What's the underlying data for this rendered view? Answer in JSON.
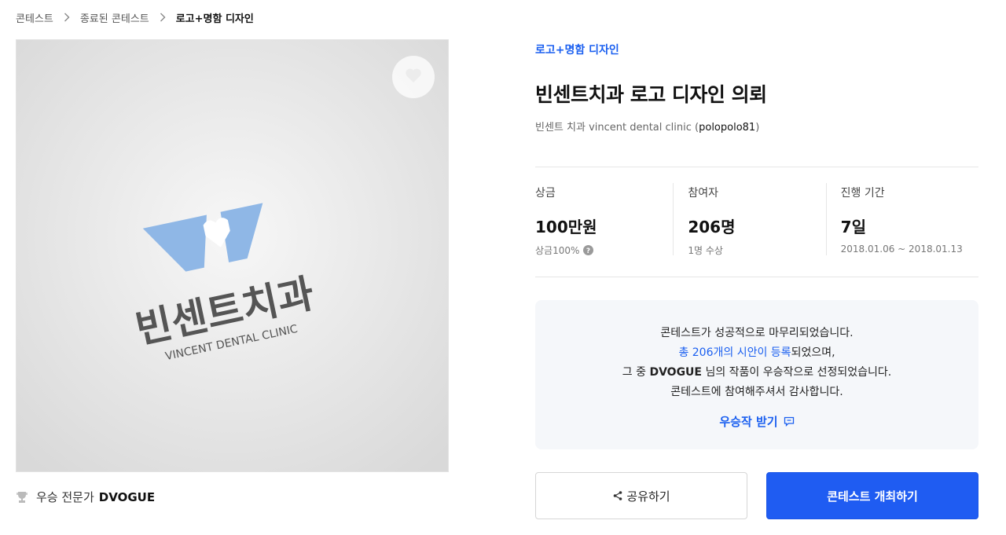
{
  "breadcrumb": {
    "items": [
      "콘테스트",
      "종료된 콘테스트",
      "로고+명함 디자인"
    ]
  },
  "image": {
    "logo_main_text": "빈센트치과",
    "logo_sub_text": "VINCENT DENTAL CLINIC",
    "like_icon": "heart-icon"
  },
  "winner": {
    "label": "우승 전문가",
    "name": "DVOGUE"
  },
  "contest": {
    "category": "로고+명함 디자인",
    "title": "빈센트치과 로고 디자인 의뢰",
    "subtitle_prefix": "빈센트 치과 vincent dental clinic (",
    "owner": "polopolo81",
    "subtitle_suffix": ")"
  },
  "stats": {
    "prize": {
      "label": "상금",
      "value": "100만원",
      "sub": "상금100%"
    },
    "participants": {
      "label": "참여자",
      "value": "206명",
      "sub": "1명 수상"
    },
    "period": {
      "label": "진행 기간",
      "value": "7일",
      "sub": "2018.01.06 ~ 2018.01.13"
    }
  },
  "notice": {
    "line1": "콘테스트가 성공적으로 마무리되었습니다.",
    "line2_link": "총 206개의 시안이 등록",
    "line2_rest": "되었으며,",
    "line3_prefix": "그 중 ",
    "line3_name": "DVOGUE",
    "line3_rest": " 님의 작품이 우승작으로 선정되었습니다.",
    "line4": "콘테스트에 참여해주셔서 감사합니다.",
    "receive_label": "우승작 받기"
  },
  "buttons": {
    "share": "공유하기",
    "host": "콘테스트 개최하기"
  },
  "colors": {
    "accent": "#1f5cf2",
    "link": "#1a5ff0",
    "notice_bg": "#f5f7fa",
    "logo_blue": "#8fb7e6"
  }
}
